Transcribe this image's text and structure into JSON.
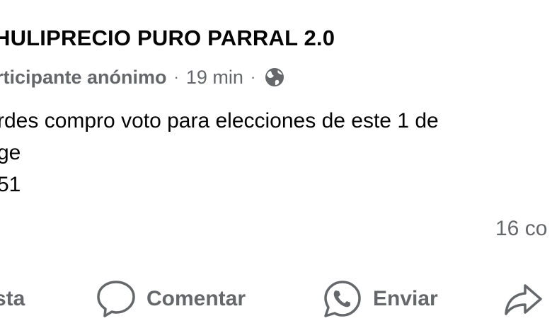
{
  "post": {
    "group_name": "HULIPRECIO PURO PARRAL 2.0",
    "author": "rticipante anónimo",
    "time": "19 min",
    "separator": "·",
    "privacy_icon": "globe-icon",
    "lines": [
      "rdes compro voto para elecciones de este 1 de",
      "ge",
      "51"
    ],
    "comments_count": "16 co"
  },
  "actions": {
    "react_label": "sta",
    "comment_label": "Comentar",
    "comment_icon": "comment-bubble-icon",
    "send_label": "Enviar",
    "send_icon": "whatsapp-icon",
    "share_icon": "share-arrow-icon"
  },
  "colors": {
    "text": "#050505",
    "muted": "#65676b",
    "background": "#ffffff"
  }
}
